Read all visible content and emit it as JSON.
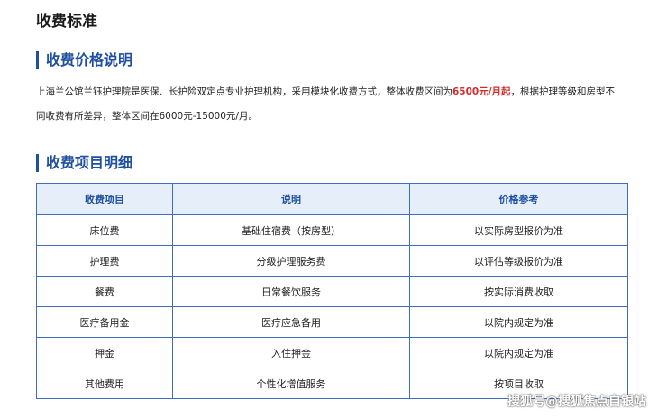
{
  "page": {
    "title": "收费标准"
  },
  "price_section": {
    "heading": "收费价格说明",
    "intro": {
      "line1_before": "上海兰公馆兰钰护理院是医保、长护险双定点专业护理机构，采用模块化收费方式，整体收费区间为",
      "line1_highlight": "6500元/月起",
      "line1_after": "，根据护理等级和房型不",
      "line2": "同收费有所差异，整体区间在6000元-15000元/月。"
    }
  },
  "items_section": {
    "heading": "收费项目明细",
    "columns": [
      "收费项目",
      "说明",
      "价格参考"
    ],
    "rows": [
      [
        "床位费",
        "基础住宿费（按房型）",
        "以实际房型报价为准"
      ],
      [
        "护理费",
        "分级护理服务费",
        "以评估等级报价为准"
      ],
      [
        "餐费",
        "日常餐饮服务",
        "按实际消费收取"
      ],
      [
        "医疗备用金",
        "医疗应急备用",
        "以院内规定为准"
      ],
      [
        "押金",
        "入住押金",
        "以院内规定为准"
      ],
      [
        "其他费用",
        "个性化增值服务",
        "按项目收取"
      ]
    ]
  },
  "watermark": {
    "text": "搜狐号@搜狐焦点自银站"
  },
  "colors": {
    "accent": "#1f4fa0",
    "table_border": "#3f6dbf",
    "header_bg": "#e6eef9",
    "highlight": "#d22d2d"
  }
}
